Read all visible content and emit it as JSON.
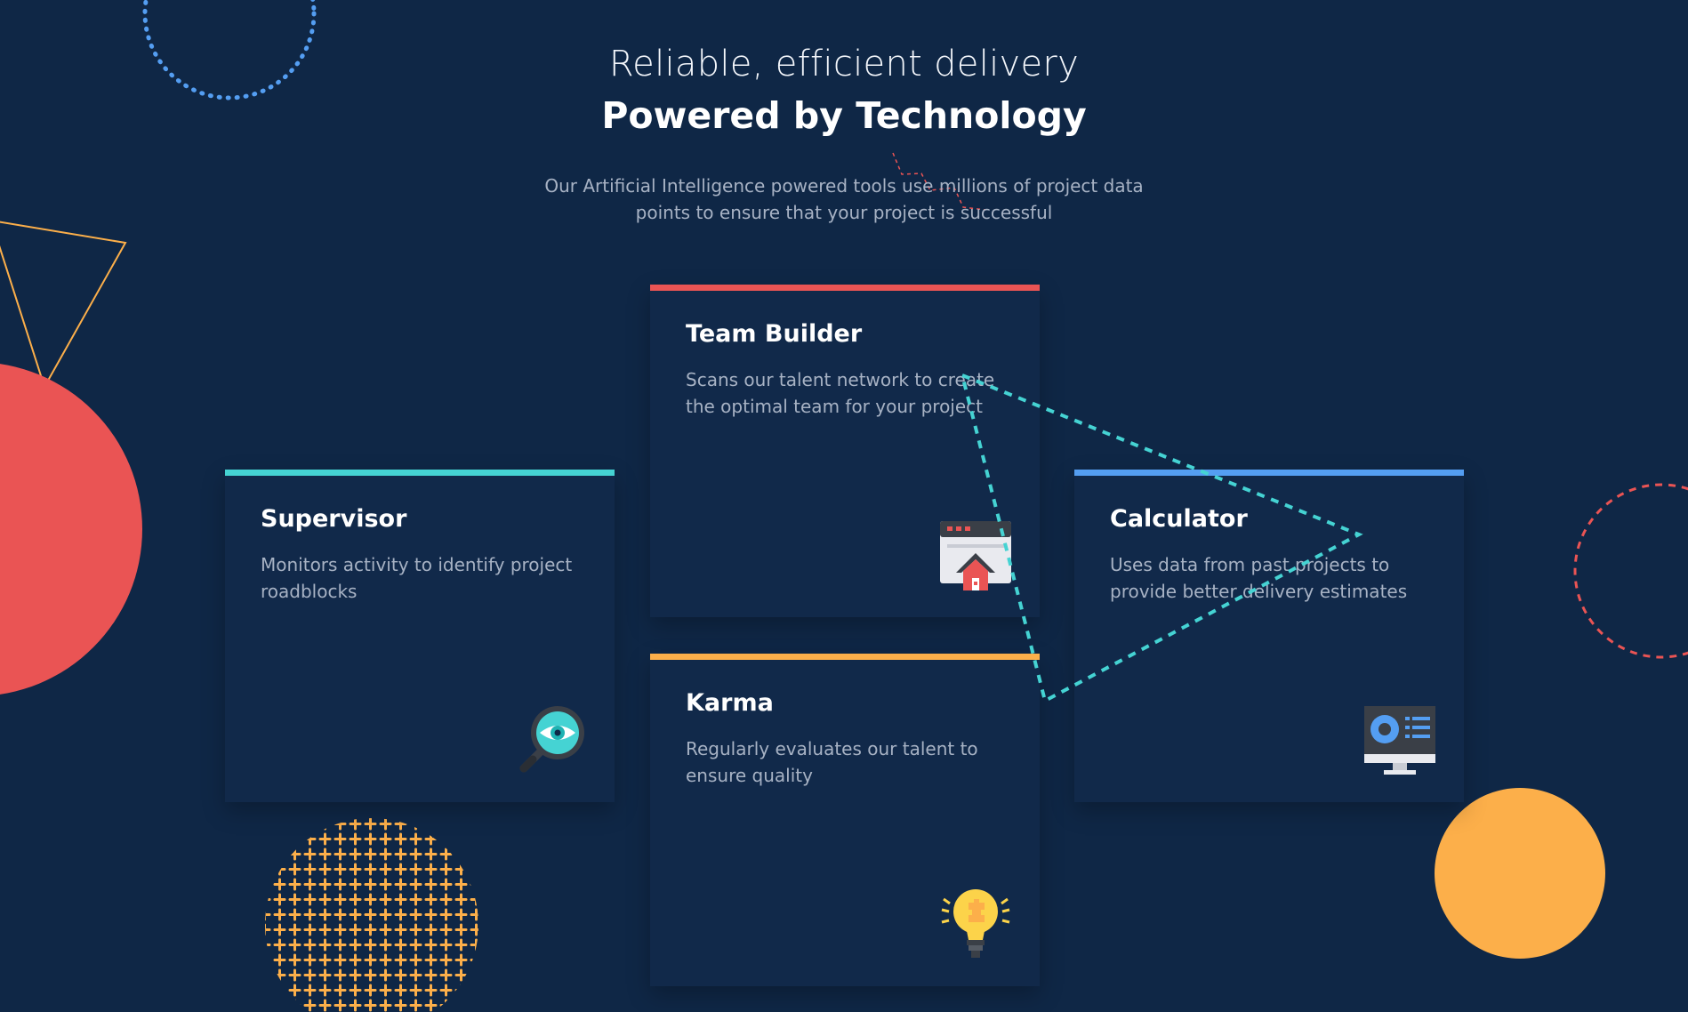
{
  "header": {
    "eyebrow": "Reliable, efficient delivery",
    "title": "Powered by Technology",
    "subtitle": "Our Artificial Intelligence powered tools use millions of project data points to ensure that your project is successful"
  },
  "cards": {
    "supervisor": {
      "title": "Supervisor",
      "description": "Monitors activity to identify project roadblocks",
      "accent": "#45d3d3",
      "icon": "magnifier-eye-icon"
    },
    "team_builder": {
      "title": "Team Builder",
      "description": "Scans our talent network to create the optimal team for your project",
      "accent": "#ea5454",
      "icon": "browser-home-icon"
    },
    "karma": {
      "title": "Karma",
      "description": "Regularly evaluates our talent to ensure quality",
      "accent": "#fcaf4a",
      "icon": "lightbulb-icon"
    },
    "calculator": {
      "title": "Calculator",
      "description": "Uses data from past projects to provide better delivery estimates",
      "accent": "#549ef2",
      "icon": "monitor-dashboard-icon"
    }
  },
  "colors": {
    "background": "#0f2746",
    "card": "#11294a",
    "red": "#ea5454",
    "orange": "#fcaf4a",
    "blue": "#549ef2",
    "cyan": "#45d3d3",
    "text_muted": "#a7b2c4"
  }
}
